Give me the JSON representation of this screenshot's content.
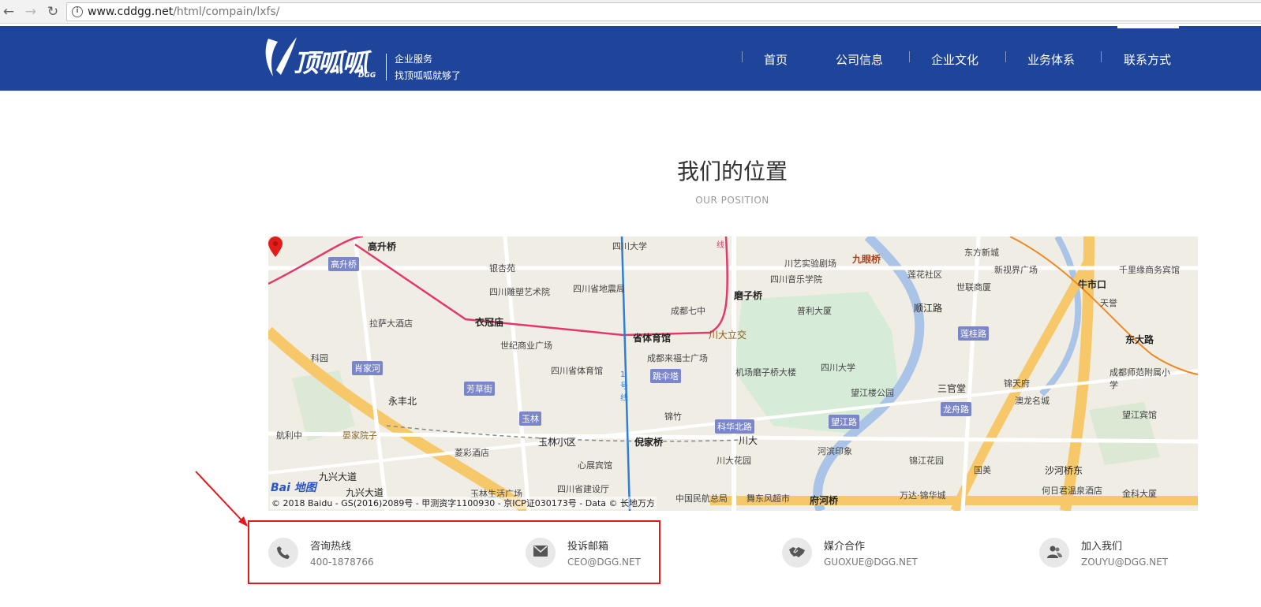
{
  "browser": {
    "url_host": "www.cddgg.net",
    "url_path": "/html/compain/lxfs/"
  },
  "header": {
    "logo_text": "顶呱呱",
    "logo_sub": "DGG",
    "slogan_line1": "企业服务",
    "slogan_line2": "找顶呱呱就够了",
    "background_color": "#1f459a",
    "nav": [
      {
        "label": "首页"
      },
      {
        "label": "公司信息"
      },
      {
        "label": "企业文化"
      },
      {
        "label": "业务体系"
      },
      {
        "label": "联系方式",
        "active": true
      }
    ]
  },
  "section": {
    "title": "我们的位置",
    "subtitle": "OUR POSITION"
  },
  "map": {
    "copyright": "© 2018 Baidu - GS(2016)2089号 - 甲测资字1100930 - 京ICP证030173号 - Data © 长地万方",
    "baidu_logo": "Bai",
    "baidu_logo_2": "地图",
    "places": {
      "gaoshengqiao": "高升桥",
      "gaoshengqiao_b": "高升桥",
      "yinxingyuan": "银杏苑",
      "sichuan_diaosu": "四川雕塑艺术院",
      "sichuan_dizhenju": "四川省地震局",
      "sichuan_daxue_top": "四川大学",
      "yiguanmiao": "衣冠庙",
      "lasa_hotel": "拉萨大酒店",
      "shiji_plaza": "世纪商业广场",
      "shengtiyuguan": "省体育馆",
      "chengdu_qizhong": "成都七中",
      "mozi_qiao": "磨子桥",
      "chuanyi_sy": "川艺实验剧场",
      "sichuan_yinyue": "四川音乐学院",
      "jiuyan_qiao": "九眼桥",
      "lianyun_sq": "莲花社区",
      "dongfang_xinyu": "东方新城",
      "xinshijie": "新视界广场",
      "shilian_yuanshu": "世联商厦",
      "niushikou": "牛市口",
      "qianlu_shangwu": "千里缘商务宾馆",
      "tianyi": "天誉",
      "dongda_lu": "东大路",
      "huacheng_lu": "顺江路",
      "pulida_sha": "普利大厦",
      "chuanda_lijiao": "川大立交",
      "kexuetang": "科园",
      "xiaojiahe": "肖家河",
      "sichuan_tiyuguan": "四川省体育馆",
      "chengdu_laifushi": "成都来福士广场",
      "tiaosanta": "跳伞塔",
      "jichang_mozi": "机场磨子桥大楼",
      "sichuan_daxue": "四川大学",
      "wangjiang_gy": "望江楼公园",
      "sanguantang": "三官堂",
      "jintian": "锦天府",
      "chengdu_shifan": "成都师范附属小学",
      "lianguilu": "莲桂路",
      "fangcaojie": "芳草街",
      "yongfengbei": "永丰北",
      "yulin": "玉林",
      "jinzhu": "锦竹",
      "kehuabei": "科华北路",
      "wangjiang_lu": "望江路",
      "longzhou_lu": "龙舟路",
      "aolong": "澳龙名城",
      "wangjiang_bg": "望江宾馆",
      "hangli_zhong": "航利中",
      "yanjia_yuan": "晏家院子",
      "yulin_xiaoqu": "玉林小区",
      "nixiqiao": "倪家桥",
      "chuanda": "川大",
      "lingcai": "菱彩酒店",
      "xinchang_bg": "心展宾馆",
      "chuanda_huayuan": "川大花园",
      "heyin": "河滨印象",
      "jinjiang_huayuan": "锦江花园",
      "guomei": "国美",
      "shahe_qiao": "沙河桥东",
      "jiuxing_1": "九兴大道",
      "jiuxing_2": "九兴大道",
      "yulin_sheng": "玉林生活广场",
      "sichuan_jianshe": "四川省建设厅",
      "zhongguo_minhang": "中国民航总局",
      "wudong": "舞东风超市",
      "fuhe_qiao": "府河桥",
      "wanda": "万达·锦华城",
      "hejun": "何日君温泉酒店",
      "jinke": "金科大厦",
      "line_1": "1号线",
      "line_2": "线"
    }
  },
  "contacts": [
    {
      "icon": "phone-icon",
      "title": "咨询热线",
      "value": "400-1878766"
    },
    {
      "icon": "mail-icon",
      "title": "投诉邮箱",
      "value": "CEO@DGG.NET"
    },
    {
      "icon": "handshake-icon",
      "title": "媒介合作",
      "value": "GUOXUE@DGG.NET"
    },
    {
      "icon": "users-icon",
      "title": "加入我们",
      "value": "ZOUYU@DGG.NET"
    }
  ],
  "annotation_color": "#e0191f"
}
